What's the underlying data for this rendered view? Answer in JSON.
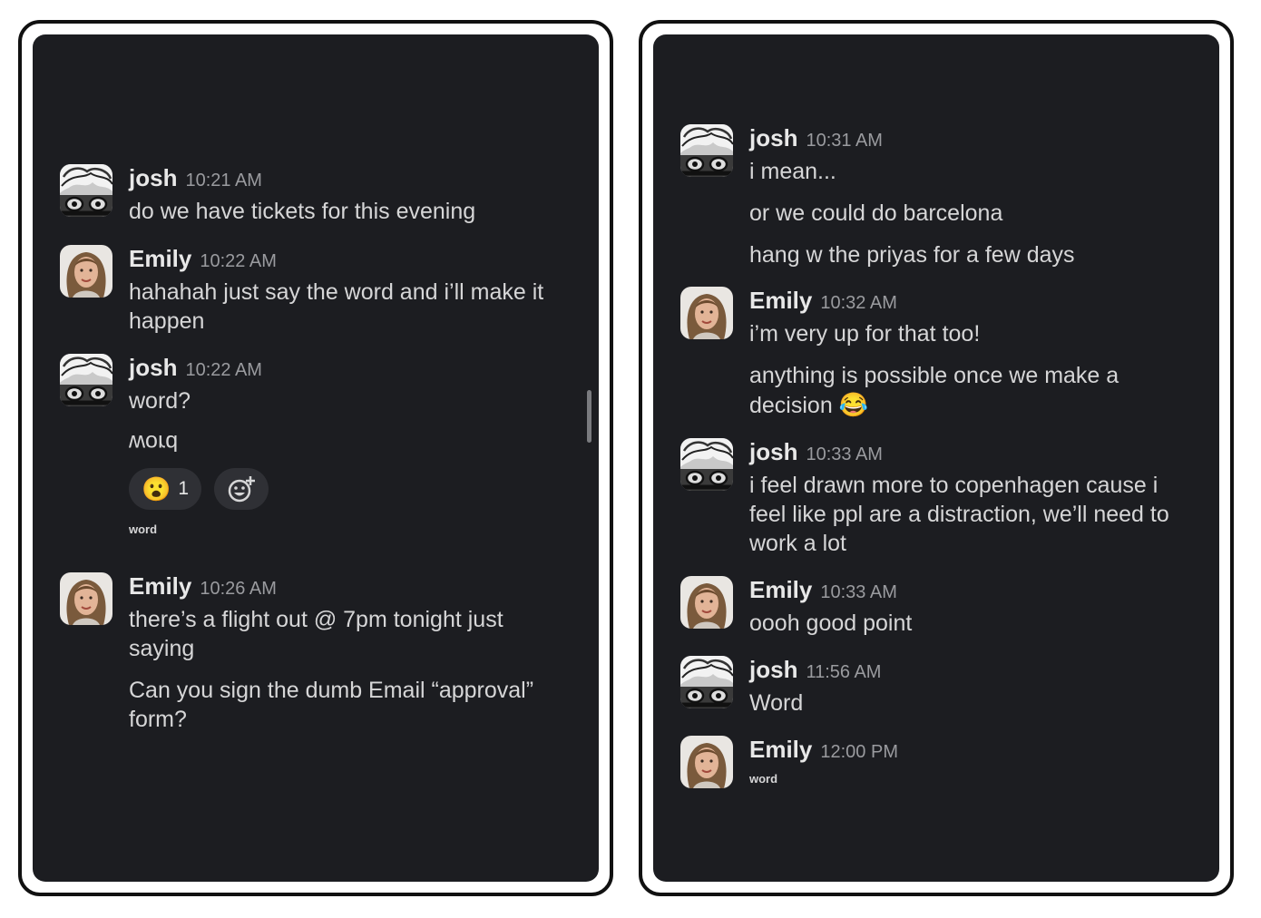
{
  "left_panel": {
    "messages": [
      {
        "author": "josh",
        "time": "10:21 AM",
        "lines": [
          "do we have tickets for this evening"
        ]
      },
      {
        "author": "Emily",
        "time": "10:22 AM",
        "lines": [
          "hahahah just say the word and i’ll make it",
          "happen"
        ]
      },
      {
        "author": "josh",
        "time": "10:22 AM",
        "lines": [
          "word?"
        ],
        "flipped_line": "word",
        "reactions": [
          {
            "emoji": "😮",
            "count": "1"
          }
        ],
        "add_reaction_icon": "add-reaction-icon",
        "caption": "word"
      },
      {
        "author": "Emily",
        "time": "10:26 AM",
        "lines": [
          "there’s a flight out @ 7pm tonight just",
          "saying"
        ],
        "lines2": [
          "Can you sign the dumb Email “approval”",
          "form?"
        ]
      }
    ]
  },
  "right_panel": {
    "messages": [
      {
        "author": "josh",
        "time": "10:31 AM",
        "lines": [
          "i mean..."
        ],
        "extra": [
          "or we could do barcelona",
          "hang w the priyas for a few days"
        ]
      },
      {
        "author": "Emily",
        "time": "10:32 AM",
        "lines": [
          "i’m very up for that too!"
        ],
        "lines2": [
          "anything is possible once we make a",
          "decision"
        ],
        "emoji": "😂"
      },
      {
        "author": "josh",
        "time": "10:33 AM",
        "lines": [
          "i feel drawn more to copenhagen cause i",
          "feel like ppl are a distraction, we’ll need to",
          "work a lot"
        ]
      },
      {
        "author": "Emily",
        "time": "10:33 AM",
        "lines": [
          "oooh good point"
        ]
      },
      {
        "author": "josh",
        "time": "11:56 AM",
        "lines": [
          "Word"
        ]
      },
      {
        "author": "Emily",
        "time": "12:00 PM",
        "caption": "word"
      }
    ]
  },
  "colors": {
    "panel_bg": "#1c1d21",
    "text": "#d6d6d7",
    "timestamp": "#9a9b9f",
    "pill_bg": "#2f3035"
  }
}
